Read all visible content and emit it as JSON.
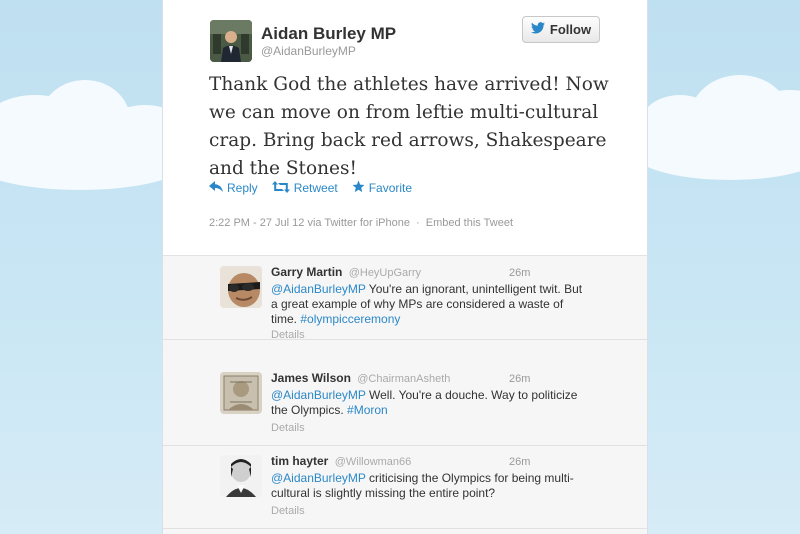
{
  "tweet": {
    "author_name": "Aidan Burley MP",
    "author_handle": "@AidanBurleyMP",
    "follow_label": "Follow",
    "text": "Thank God the athletes have arrived! Now we can move on from leftie multi-cultural crap. Bring back red arrows, Shakespeare and the Stones!",
    "actions": {
      "reply": "Reply",
      "retweet": "Retweet",
      "favorite": "Favorite"
    },
    "timestamp": "2:22 PM - 27 Jul 12",
    "via": "via Twitter for iPhone",
    "embed": "Embed this Tweet"
  },
  "replies": [
    {
      "name": "Garry Martin",
      "handle": "@HeyUpGarry",
      "time": "26m",
      "mention": "@AidanBurleyMP",
      "text": " You're an ignorant, unintelligent twit. But a great example of why MPs are considered a waste of time. ",
      "hashtag": "#olympicceremony",
      "details": "Details"
    },
    {
      "name": "James Wilson",
      "handle": "@ChairmanAsheth",
      "time": "26m",
      "mention": "@AidanBurleyMP",
      "text": " Well. You're a douche. Way to politicize the Olympics. ",
      "hashtag": "#Moron",
      "details": "Details"
    },
    {
      "name": "tim hayter",
      "handle": "@Willowman66",
      "time": "26m",
      "mention": "@AidanBurleyMP",
      "text": " criticising the Olympics for being multi-cultural is slightly missing the entire point?",
      "hashtag": "",
      "details": "Details"
    }
  ],
  "colors": {
    "link": "#2b88c8",
    "sky": "#bfe0f1"
  },
  "icons": [
    "twitter-bird-icon",
    "reply-icon",
    "retweet-icon",
    "star-icon"
  ]
}
